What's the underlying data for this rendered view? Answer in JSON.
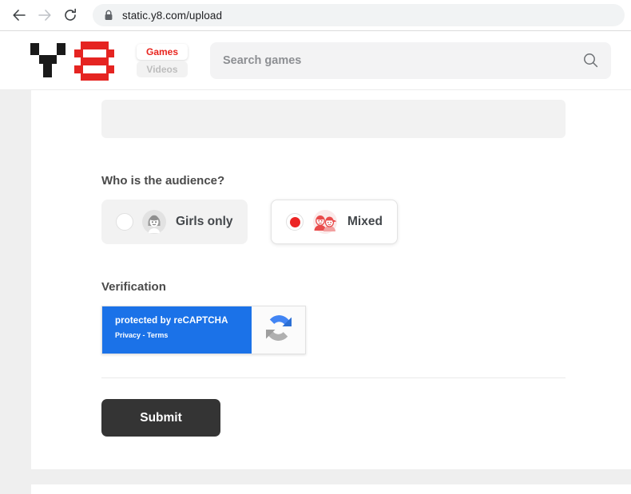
{
  "browser": {
    "back_icon": "back-arrow-icon",
    "forward_icon": "forward-arrow-icon",
    "reload_icon": "reload-icon",
    "lock_icon": "lock-icon",
    "url": "static.y8.com/upload"
  },
  "site_header": {
    "logo_alt": "y8-logo",
    "logo_colors": {
      "y": "#1a1a1a",
      "eight": "#e52421"
    },
    "tabs": [
      {
        "label": "Games",
        "active": true
      },
      {
        "label": "Videos",
        "active": false
      }
    ],
    "search": {
      "placeholder": "Search games",
      "icon": "search-icon"
    }
  },
  "form": {
    "title_field_value": "",
    "audience": {
      "label": "Who is the audience?",
      "options": [
        {
          "label": "Girls only",
          "selected": false,
          "avatar": "girl-avatar-icon"
        },
        {
          "label": "Mixed",
          "selected": true,
          "avatar": "mixed-kids-avatar-icon"
        }
      ]
    },
    "verification": {
      "label": "Verification",
      "recaptcha_title": "protected by reCAPTCHA",
      "recaptcha_links": "Privacy - Terms",
      "recaptcha_logo": "recaptcha-logo-icon",
      "brand_color": "#1b72e8"
    },
    "submit_label": "Submit"
  },
  "colors": {
    "accent_red": "#e52421",
    "page_background": "#efefef",
    "card_background": "#ffffff",
    "submit_background": "#343434"
  }
}
